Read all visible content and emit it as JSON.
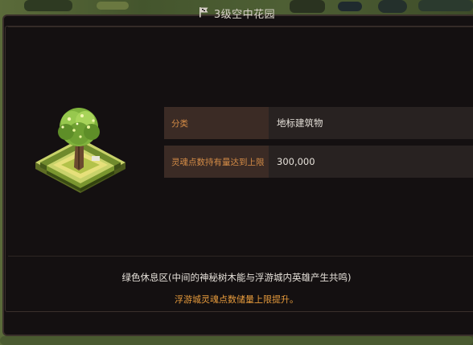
{
  "window": {
    "title": "3级空中花园",
    "title_icon": "flag-icon"
  },
  "building": {
    "image_icon": "sky-garden-building-icon"
  },
  "info": {
    "rows": [
      {
        "label": "分类",
        "value": "地标建筑物"
      },
      {
        "label": "灵魂点数持有量达到上限",
        "value": "300,000"
      }
    ]
  },
  "description": {
    "main": "绿色休息区(中间的神秘树木能与浮游城内英雄产生共鸣)",
    "effect": "浮游城灵魂点数储量上限提升。"
  },
  "colors": {
    "panel_bg": "#141011",
    "label_bg": "#3b2b25",
    "value_bg": "#282221",
    "label_text": "#d38b46",
    "effect_text": "#e79b3c",
    "title_text": "#d8d2c8"
  }
}
